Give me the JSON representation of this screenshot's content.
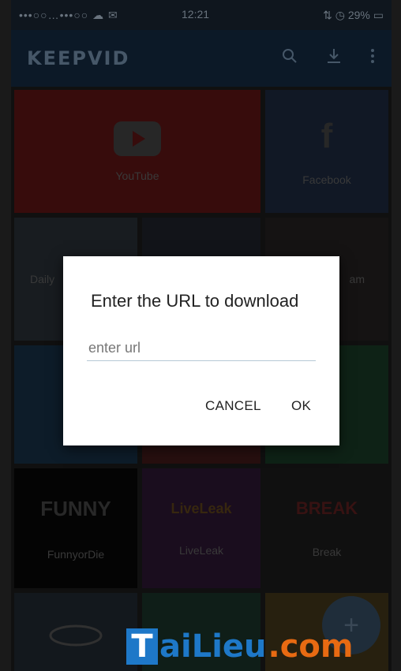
{
  "status_bar": {
    "left_icons": "•••○○…•••○○ ☁ ✉",
    "time": "12:21",
    "right_text": "⇅ ◷ 29% ▭"
  },
  "app_bar": {
    "brand": "KEEPVID",
    "icons": [
      "search-icon",
      "download-icon",
      "more-vert-icon"
    ]
  },
  "tiles": [
    {
      "label": "YouTube",
      "logo": "▶",
      "color": "#3a0d0d"
    },
    {
      "label": "Facebook",
      "logo": "f",
      "color": "#121a28"
    },
    {
      "label": "Daily",
      "logo": "",
      "color": "#1a1e22"
    },
    {
      "label": "",
      "logo": "",
      "color": "#14161b"
    },
    {
      "label": "am",
      "logo": "",
      "color": "#171515"
    },
    {
      "label": "",
      "logo": "",
      "color": "#0e1e2c"
    },
    {
      "label": "",
      "logo": "",
      "color": "#2a1010"
    },
    {
      "label": "",
      "logo": "",
      "color": "#0f2418"
    },
    {
      "label": "FunnyorDie",
      "logo": "FUNNY",
      "color": "#050505"
    },
    {
      "label": "LiveLeak",
      "logo": "LiveLeak",
      "color": "#1c0e20"
    },
    {
      "label": "Break",
      "logo": "BREAK",
      "color": "#111111"
    },
    {
      "label": "",
      "logo": "",
      "color": "#151a1f"
    },
    {
      "label": "",
      "logo": "",
      "color": "#10201a"
    },
    {
      "label": "",
      "logo": "",
      "color": "#2a2210"
    }
  ],
  "dialog": {
    "title": "Enter the URL to download",
    "input_placeholder": "enter url",
    "cancel_label": "CANCEL",
    "ok_label": "OK"
  },
  "fab": {
    "icon": "add-icon",
    "glyph": "+"
  },
  "watermark": {
    "first_letter": "T",
    "middle": "aiLieu",
    "suffix": ".com"
  }
}
